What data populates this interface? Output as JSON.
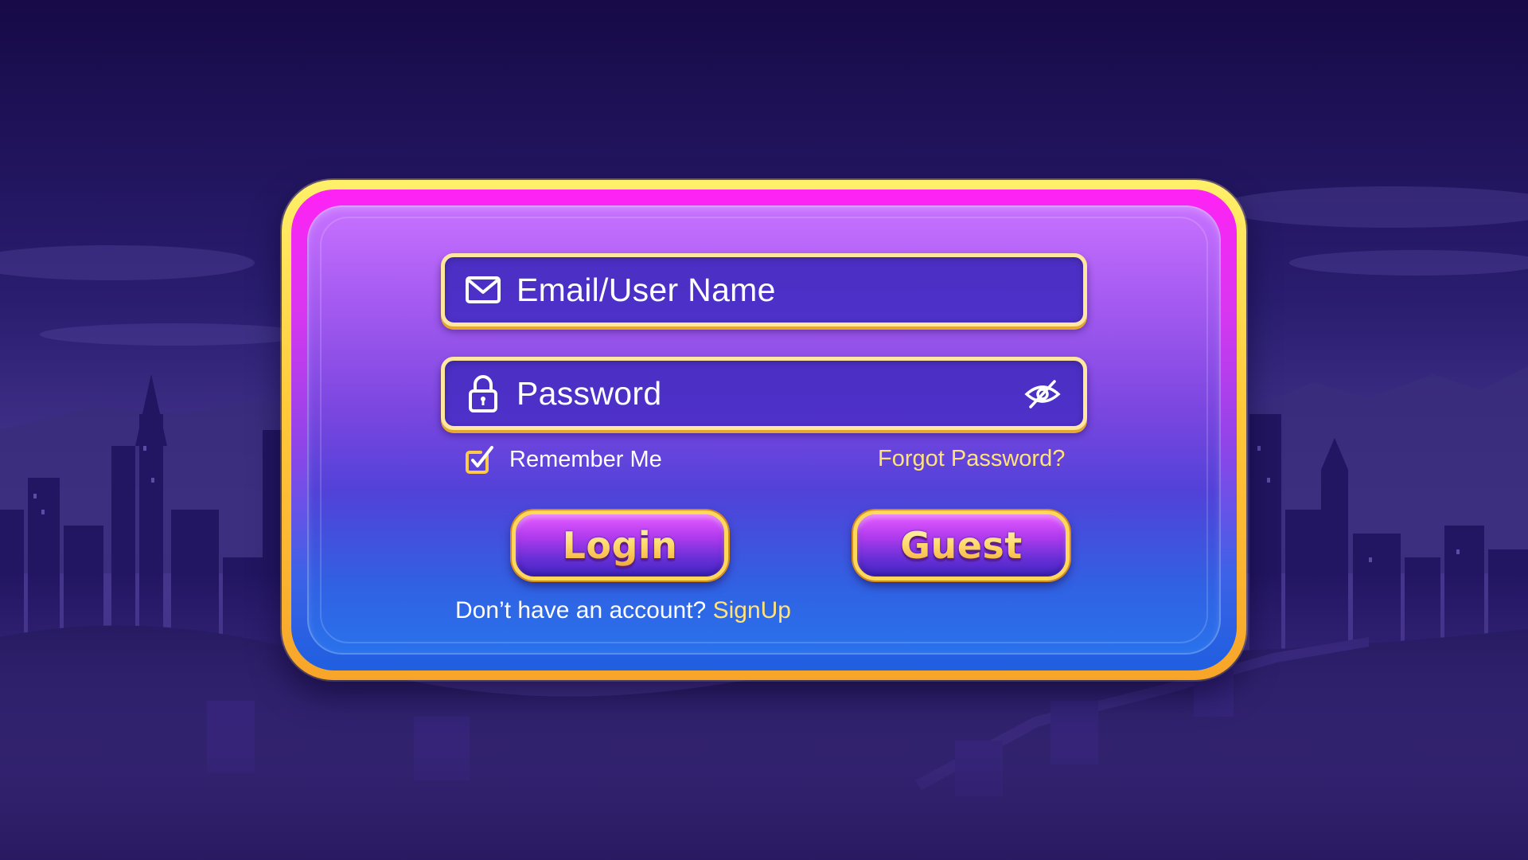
{
  "login_form": {
    "email_placeholder": "Email/User Name",
    "password_placeholder": "Password",
    "remember_me_label": "Remember Me",
    "remember_me_checked": true,
    "forgot_password_label": "Forgot Password?",
    "login_button_label": "Login",
    "guest_button_label": "Guest",
    "signup_prompt": "Don’t have an account?",
    "signup_link_label": "SignUp"
  },
  "icons": {
    "email": "envelope-icon",
    "password": "lock-icon",
    "visibility": "eye-off-icon",
    "remember": "checkbox-checked-icon"
  },
  "colors": {
    "accent_gold": "#ffd85a",
    "link_yellow": "#ffe27a",
    "field_fill": "#4b2fc4",
    "panel_top": "#ff22f4",
    "panel_bottom": "#1f5fe0"
  }
}
